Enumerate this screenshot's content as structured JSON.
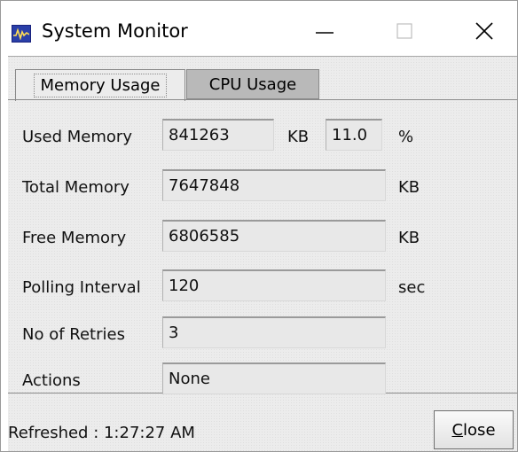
{
  "window": {
    "title": "System Monitor"
  },
  "tabs": [
    {
      "label": "Memory Usage",
      "selected": true
    },
    {
      "label": "CPU Usage",
      "selected": false
    }
  ],
  "fields": {
    "used_memory": {
      "label": "Used Memory",
      "value": "841263",
      "unit": "KB",
      "percent": "11.0",
      "percent_unit": "%"
    },
    "total_memory": {
      "label": "Total Memory",
      "value": "7647848",
      "unit": "KB"
    },
    "free_memory": {
      "label": "Free Memory",
      "value": "6806585",
      "unit": "KB"
    },
    "polling_interval": {
      "label": "Polling Interval",
      "value": "120",
      "unit": "sec"
    },
    "retries": {
      "label": "No of Retries",
      "value": "3"
    },
    "actions": {
      "label": "Actions",
      "value": "None"
    }
  },
  "footer": {
    "status": "Refreshed : 1:27:27 AM",
    "close_label_first": "C",
    "close_label_rest": "lose"
  },
  "icons": {
    "app": "system-monitor-icon",
    "minimize": "minimize-icon",
    "maximize": "maximize-icon",
    "close": "close-icon"
  },
  "colors": {
    "app_icon": "#2a3fa8",
    "content_bg": "#ececec",
    "inactive_tab": "#b9b9b9"
  }
}
